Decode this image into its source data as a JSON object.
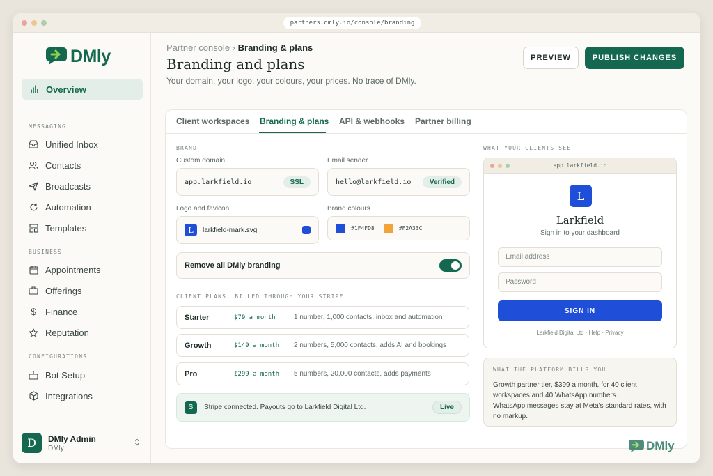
{
  "browser": {
    "url": "partners.dmly.io/console/branding"
  },
  "brand": {
    "name": "DMly",
    "color": "#13684f"
  },
  "sidebar": {
    "active": "Overview",
    "sections": {
      "messaging": "MESSAGING",
      "business": "BUSINESS",
      "configurations": "CONFIGURATIONS"
    },
    "messaging": [
      "Unified Inbox",
      "Contacts",
      "Broadcasts",
      "Automation",
      "Templates"
    ],
    "business": [
      "Appointments",
      "Offerings",
      "Finance",
      "Reputation"
    ],
    "configurations": [
      "Bot Setup",
      "Integrations"
    ],
    "user": {
      "initial": "D",
      "name": "DMly Admin",
      "org": "DMly"
    }
  },
  "header": {
    "crumb_parent": "Partner console ›",
    "crumb_current": "Branding & plans",
    "title": "Branding and plans",
    "subtitle": "Your domain, your logo, your colours, your prices. No trace of DMly.",
    "preview_label": "PREVIEW",
    "publish_label": "PUBLISH CHANGES"
  },
  "tabs": [
    "Client workspaces",
    "Branding & plans",
    "API & webhooks",
    "Partner billing"
  ],
  "brand_section": {
    "heading": "BRAND",
    "domain_label": "Custom domain",
    "domain_value": "app.larkfield.io",
    "domain_badge": "SSL",
    "sender_label": "Email sender",
    "sender_value": "hello@larkfield.io",
    "sender_badge": "Verified",
    "logo_label": "Logo and favicon",
    "logo_initial": "L",
    "logo_file": "larkfield-mark.svg",
    "colours_label": "Brand colours",
    "colour1": "#1F4FD8",
    "colour2": "#F2A33C",
    "remove_branding_label": "Remove all DMly branding",
    "remove_branding_on": true
  },
  "plans": {
    "heading": "CLIENT PLANS, BILLED THROUGH YOUR STRIPE",
    "items": [
      {
        "name": "Starter",
        "price": "$79 a month",
        "desc": "1 number, 1,000 contacts, inbox and automation"
      },
      {
        "name": "Growth",
        "price": "$149 a month",
        "desc": "2 numbers, 5,000 contacts, adds AI and bookings"
      },
      {
        "name": "Pro",
        "price": "$299 a month",
        "desc": "5 numbers, 20,000 contacts, adds payments"
      }
    ],
    "stripe_icon": "S",
    "stripe_text": "Stripe connected. Payouts go to Larkfield Digital Ltd.",
    "stripe_badge": "Live"
  },
  "client_preview": {
    "heading": "WHAT YOUR CLIENTS SEE",
    "url": "app.larkfield.io",
    "logo_initial": "L",
    "company": "Larkfield",
    "tagline": "Sign in to your dashboard",
    "email_placeholder": "Email address",
    "password_placeholder": "Password",
    "signin_label": "SIGN IN",
    "footer": "Larkfield Digital Ltd · Help · Privacy"
  },
  "platform_bill": {
    "heading": "WHAT THE PLATFORM BILLS YOU",
    "line1": "Growth partner tier, $399 a month, for 40 client workspaces and 40 WhatsApp numbers.",
    "line2": "WhatsApp messages stay at Meta's standard rates, with no markup."
  }
}
